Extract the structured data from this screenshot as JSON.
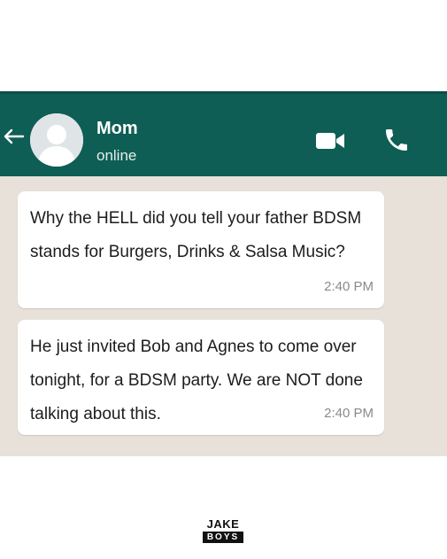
{
  "header": {
    "contact_name": "Mom",
    "status": "online",
    "back_icon": "arrow-left-icon",
    "video_icon": "video-camera-icon",
    "call_icon": "phone-icon",
    "color": "#0e5e55"
  },
  "messages": [
    {
      "text": "Why the HELL did you tell your father BDSM stands for Burgers, Drinks & Salsa Music?",
      "time": "2:40 PM"
    },
    {
      "text": "He just invited Bob and Agnes to come over tonight, for a BDSM party. We are NOT done talking about this.",
      "time": "2:40 PM"
    }
  ],
  "watermark": {
    "line1": "JAKE",
    "line2": "BOYS"
  },
  "colors": {
    "chat_background": "#e7e1d9",
    "bubble": "#ffffff",
    "timestamp": "#8a8a8a"
  }
}
